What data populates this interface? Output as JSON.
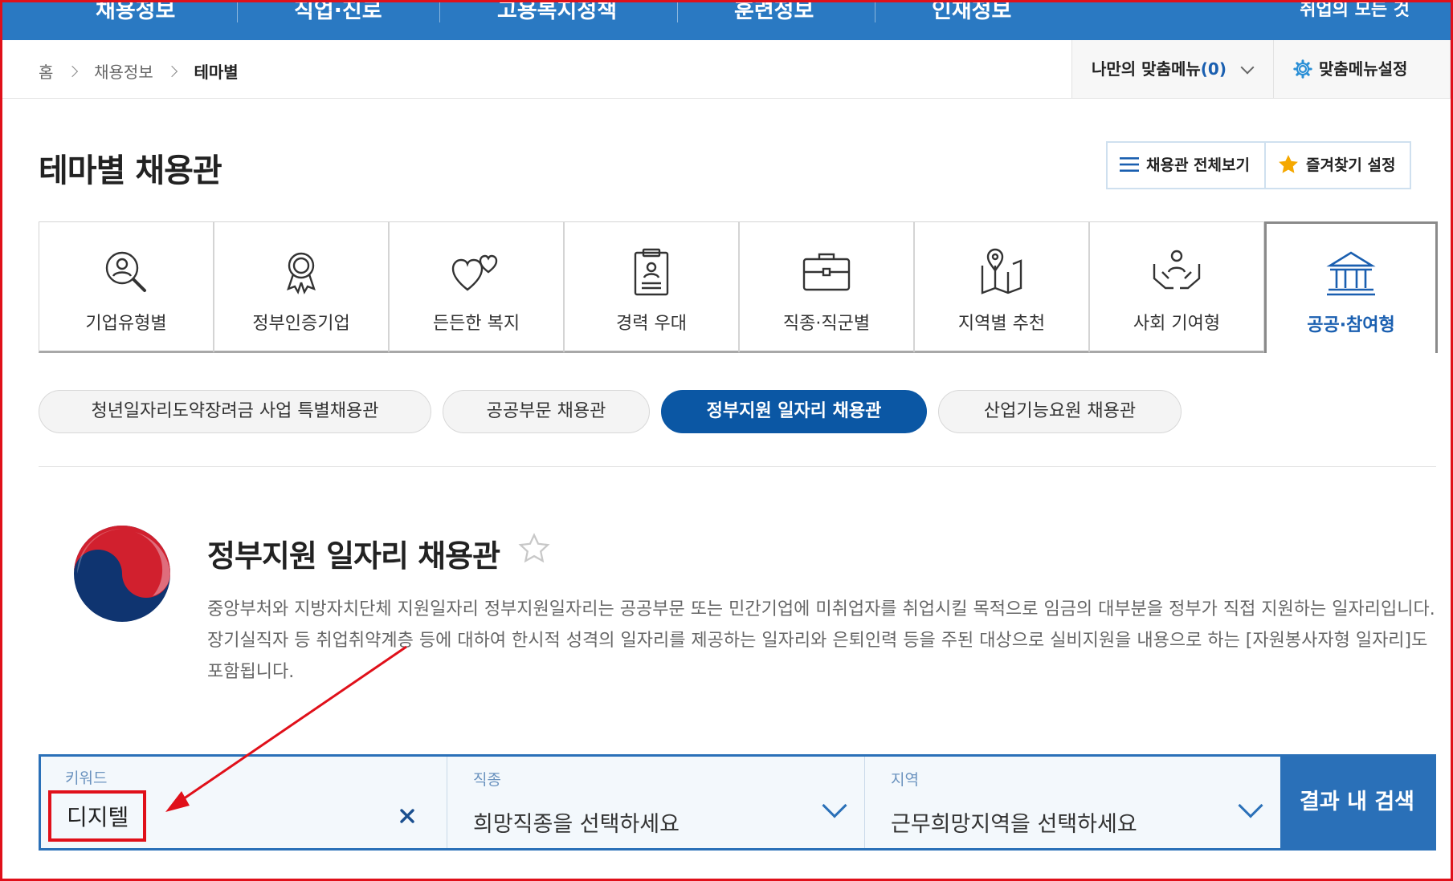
{
  "topnav": {
    "items": [
      "채용정보",
      "직업·진로",
      "고용복지정책",
      "훈련정보",
      "인재정보"
    ],
    "right": "취업의 모든 것"
  },
  "breadcrumb": {
    "home": "홈",
    "level1": "채용정보",
    "current": "테마별"
  },
  "mymenu": {
    "label": "나만의 맞춤메뉴",
    "count": "(0)"
  },
  "custom_menu": {
    "label": "맞춤메뉴설정"
  },
  "page_title": "테마별 채용관",
  "buttons": {
    "view_all": "채용관 전체보기",
    "favorites": "즐겨찾기 설정"
  },
  "tiles": [
    {
      "label": "기업유형별",
      "icon": "person-search-icon"
    },
    {
      "label": "정부인증기업",
      "icon": "award-badge-icon"
    },
    {
      "label": "든든한 복지",
      "icon": "hearts-icon"
    },
    {
      "label": "경력 우대",
      "icon": "clipboard-person-icon"
    },
    {
      "label": "직종·직군별",
      "icon": "briefcase-icon"
    },
    {
      "label": "지역별 추천",
      "icon": "map-pin-icon"
    },
    {
      "label": "사회 기여형",
      "icon": "hands-person-icon"
    },
    {
      "label": "공공·참여형",
      "icon": "government-building-icon"
    }
  ],
  "pills": [
    "청년일자리도약장려금 사업 특별채용관",
    "공공부문 채용관",
    "정부지원 일자리 채용관",
    "산업기능요원 채용관"
  ],
  "section": {
    "title": "정부지원 일자리 채용관",
    "desc": "중앙부처와 지방자치단체 지원일자리 정부지원일자리는 공공부문 또는 민간기업에 미취업자를 취업시킬 목적으로 임금의 대부분을 정부가 직접 지원하는 일자리입니다. 장기실직자 등 취업취약계층 등에 대하여 한시적 성격의 일자리를 제공하는 일자리와 은퇴인력 등을 주된 대상으로 실비지원을 내용으로 하는 [자원봉사자형 일자리]도 포함됩니다."
  },
  "search": {
    "keyword_label": "키워드",
    "keyword_value": "디지텔",
    "job_label": "직종",
    "job_placeholder": "희망직종을 선택하세요",
    "region_label": "지역",
    "region_placeholder": "근무희망지역을 선택하세요",
    "submit": "결과 내 검색"
  },
  "colors": {
    "nav": "#2a79c2",
    "accent": "#0b57a4",
    "annotation": "#e0101a"
  }
}
